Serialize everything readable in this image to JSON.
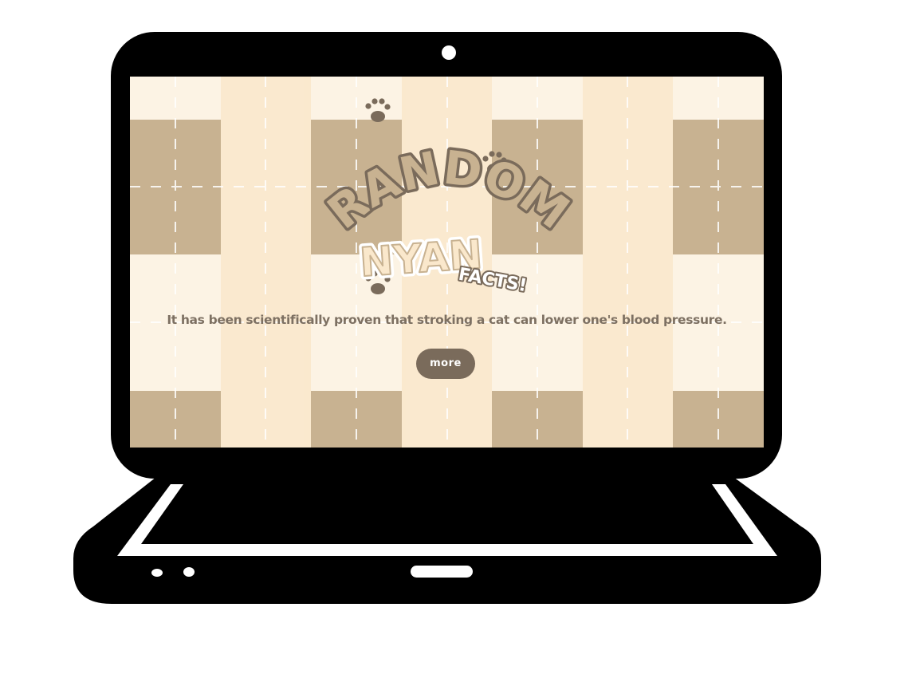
{
  "logo": {
    "word_random": "RANDOM",
    "word_nyan": "NYAN",
    "word_facts": "FACTS!"
  },
  "fact": {
    "text": "It has been scientifically proven that stroking a cat can lower one's blood pressure."
  },
  "more_button": {
    "label": "more"
  },
  "colors": {
    "tan": "#c8b291",
    "cream": "#fcf3e4",
    "peach": "#fae8cc",
    "brown_outline": "#7a6b5b",
    "text": "#7d7062",
    "button": "#7a6b5b",
    "laptop": "#000000"
  },
  "icons": [
    "paw-print-icon",
    "webcam-icon",
    "trackpad-icon",
    "status-light-icon"
  ]
}
